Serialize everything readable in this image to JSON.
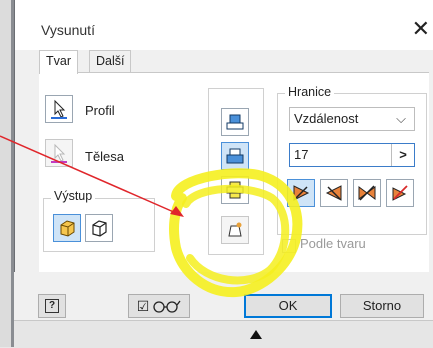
{
  "window": {
    "title": "Vysunutí",
    "close_glyph": "✕"
  },
  "tabs": [
    {
      "label": "Tvar",
      "active": true
    },
    {
      "label": "Další",
      "active": false
    }
  ],
  "profile": {
    "label": "Profil"
  },
  "bodies": {
    "label": "Tělesa"
  },
  "output": {
    "label": "Výstup"
  },
  "bounds": {
    "label": "Hranice",
    "type_value": "Vzdálenost",
    "distance_value": "17",
    "arrow_label": ">"
  },
  "match_shape": {
    "label": "Podle tvaru",
    "checked": false
  },
  "buttons": {
    "ok": "OK",
    "cancel": "Storno",
    "help": "?"
  },
  "colors": {
    "accent": "#0078d7",
    "highlight": "#f5ef1f",
    "annotation": "#e0262b"
  }
}
